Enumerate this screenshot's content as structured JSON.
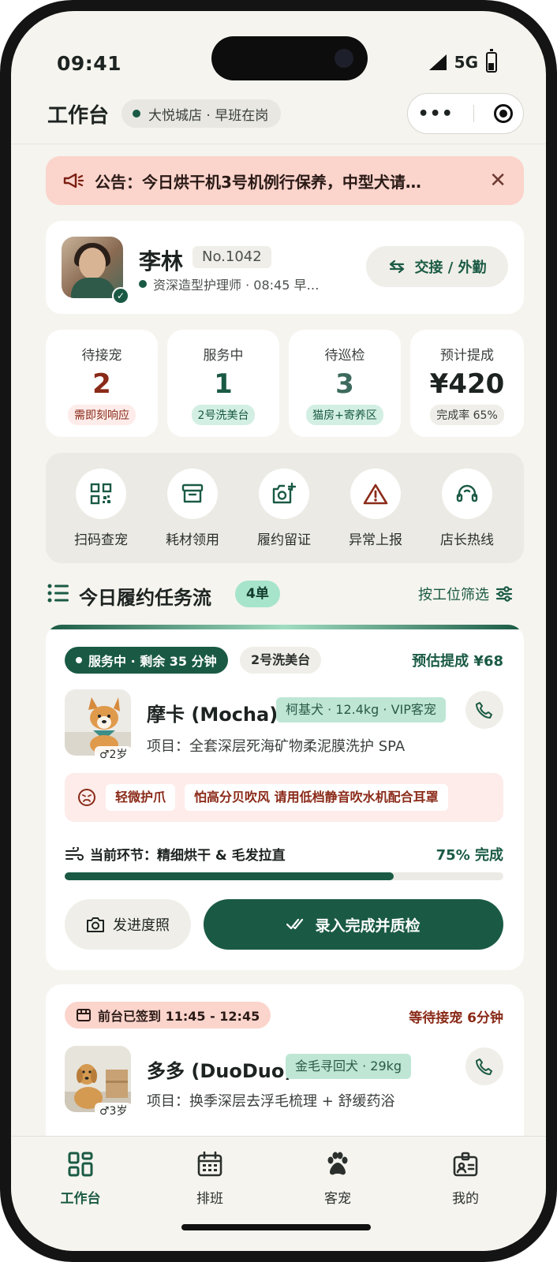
{
  "status": {
    "time": "09:41",
    "network": "5G"
  },
  "header": {
    "title": "工作台",
    "store": "大悦城店 · 早班在岗",
    "more_icon": "more-dots-icon",
    "target_icon": "record-icon"
  },
  "notice": {
    "text": "公告：今日烘干机3号机例行保养，中型犬请…",
    "icon": "megaphone-icon"
  },
  "profile": {
    "name": "李林",
    "number": "No.1042",
    "role": "资深造型护理师 · 08:45 早…",
    "action": "交接 / 外勤"
  },
  "stats": [
    {
      "label": "待接宠",
      "value": "2",
      "tag": "需即刻响应",
      "color": "#8a2a18",
      "tag_bg": "#fdecea"
    },
    {
      "label": "服务中",
      "value": "1",
      "tag": "2号洗美台",
      "color": "#1a5a44",
      "tag_bg": "#d3efe3"
    },
    {
      "label": "待巡检",
      "value": "3",
      "tag": "猫房+寄养区",
      "color": "#3c6a5c",
      "tag_bg": "#d3efe3"
    },
    {
      "label": "预计提成",
      "value": "¥420",
      "tag": "完成率 65%",
      "color": "#1d2320",
      "tag_bg": "#efeee8"
    }
  ],
  "quick_actions": [
    {
      "label": "扫码查宠",
      "icon": "qr-scan-icon"
    },
    {
      "label": "耗材领用",
      "icon": "archive-box-icon"
    },
    {
      "label": "履约留证",
      "icon": "add-photo-icon"
    },
    {
      "label": "异常上报",
      "icon": "warning-icon"
    },
    {
      "label": "店长热线",
      "icon": "headset-icon"
    }
  ],
  "section": {
    "title": "今日履约任务流",
    "count": "4单",
    "filter": "按工位筛选"
  },
  "task1": {
    "status": "服务中 · 剩余 35 分钟",
    "station": "2号洗美台",
    "estimate": "预估提成 ¥68",
    "pet_name": "摩卡 (Mocha)",
    "breed": "柯基犬 · 12.4kg · VIP客宠",
    "age": "♂2岁",
    "service": "项目：全套深层死海矿物柔泥膜洗护 SPA",
    "warnings": [
      "轻微护爪",
      "怕高分贝吹风 请用低档静音吹水机配合耳罩"
    ],
    "stage": "当前环节：精细烘干 & 毛发拉直",
    "progress_label": "75% 完成",
    "progress": 0.75,
    "photo_btn": "发进度照",
    "done_btn": "录入完成并质检"
  },
  "task2": {
    "status": "前台已签到 11:45 - 12:45",
    "wait": "等待接宠 6分钟",
    "pet_name": "多多 (DuoDuo)",
    "breed": "金毛寻回犬 · 29kg",
    "age": "♂3岁",
    "service": "项目：换季深层去浮毛梳理 + 舒缓药浴"
  },
  "tabs": [
    {
      "label": "工作台",
      "icon": "dashboard-icon",
      "active": true
    },
    {
      "label": "排班",
      "icon": "calendar-icon",
      "active": false
    },
    {
      "label": "客宠",
      "icon": "paw-icon",
      "active": false
    },
    {
      "label": "我的",
      "icon": "badge-icon",
      "active": false
    }
  ]
}
